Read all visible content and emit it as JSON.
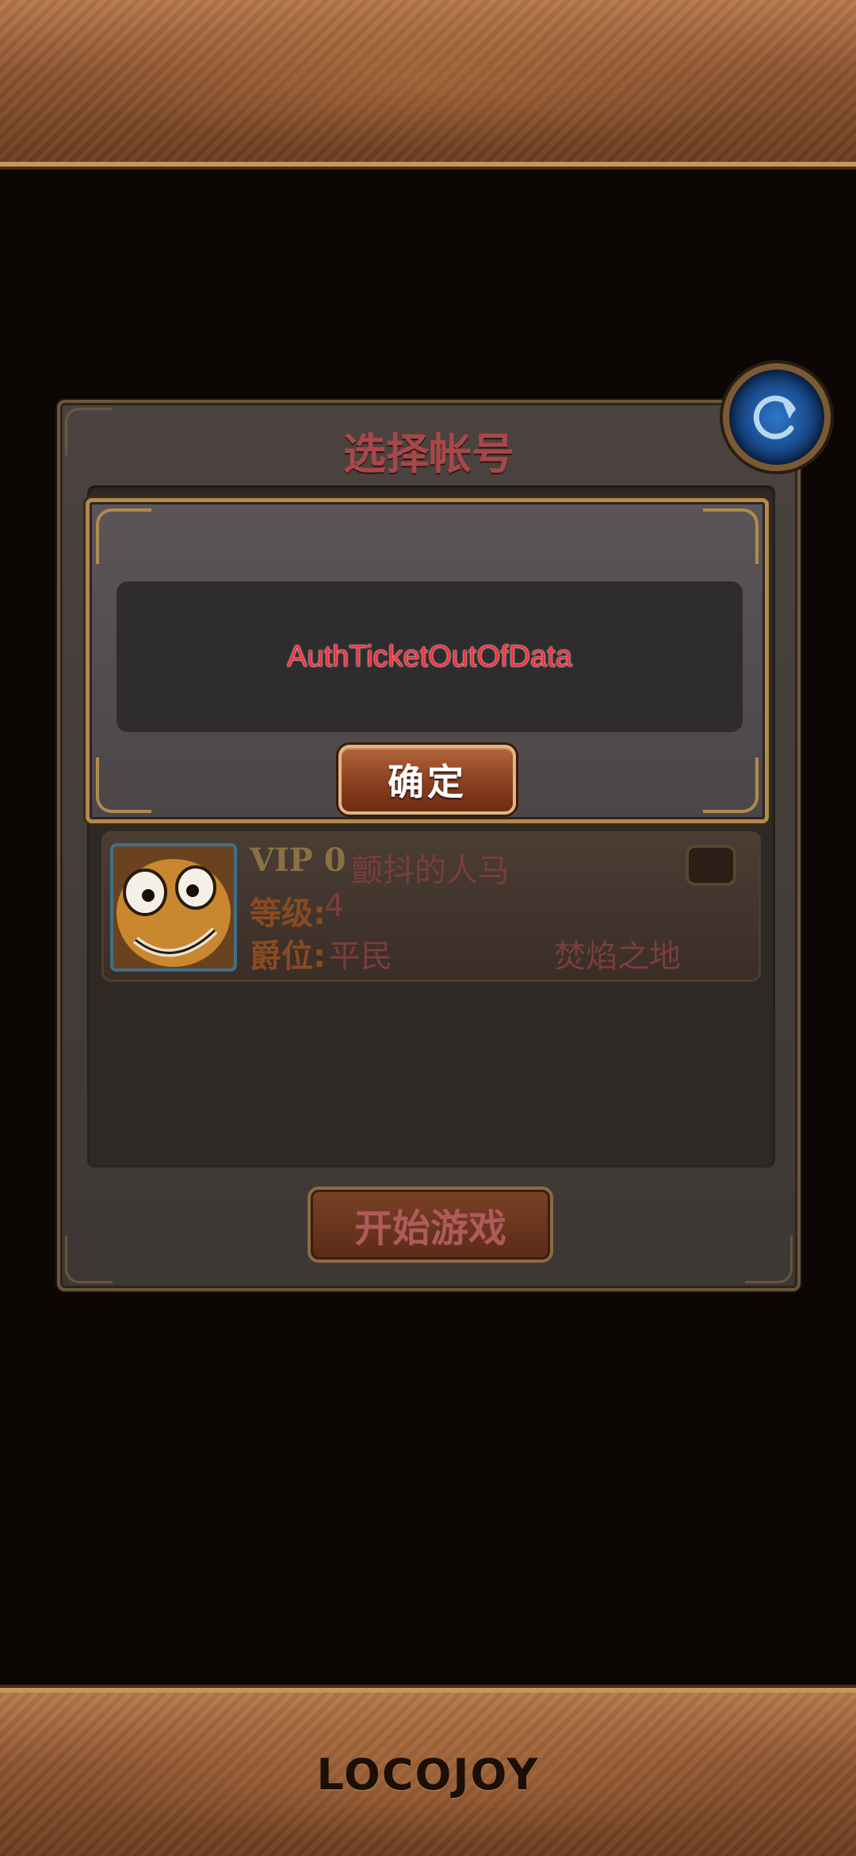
{
  "panel": {
    "title": "选择帐号",
    "start_button": "开始游戏"
  },
  "account": {
    "vip": "VIP 0",
    "name": "颤抖的人马",
    "level_label": "等级:",
    "level_value": "4",
    "rank_label": "爵位:",
    "rank_value": "平民",
    "server": "焚焰之地"
  },
  "dialog": {
    "message": "AuthTicketOutOfData",
    "confirm_button": "确定"
  },
  "brand": {
    "logo": "LOCOJOY"
  },
  "icons": {
    "refresh": "refresh-icon",
    "avatar": "character-avatar"
  },
  "colors": {
    "accent_gold": "#b18a4e",
    "error_text": "#ff2f3c",
    "title_red": "#a8474a"
  }
}
